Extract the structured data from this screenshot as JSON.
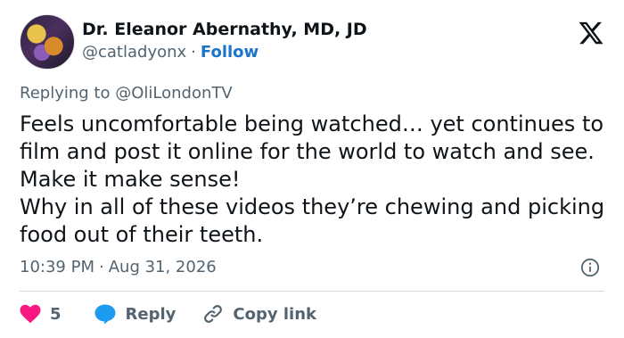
{
  "author": {
    "display_name": "Dr. Eleanor Abernathy, MD, JD",
    "handle": "@catladyonx",
    "separator": "·",
    "follow_label": "Follow"
  },
  "reply_context": {
    "prefix": "Replying to",
    "mention": "@OliLondonTV"
  },
  "tweet": {
    "lines": [
      "Feels uncomfortable being watched… yet continues to film and post it online for the world to watch and see. Make it make sense!",
      "Why in all of these videos they’re chewing and picking food out of their teeth."
    ],
    "time": "10:39 PM",
    "separator": "·",
    "date": "Aug 31, 2026"
  },
  "actions": {
    "like_count": "5",
    "reply_label": "Reply",
    "copy_label": "Copy link"
  },
  "colors": {
    "text": "#0f1419",
    "muted": "#536471",
    "follow": "#1d74c9",
    "like": "#f91880",
    "reply_bubble": "#1d9bf0",
    "divider": "#cfd9de"
  },
  "icons": [
    "x-logo-icon",
    "info-icon",
    "heart-icon",
    "reply-bubble-icon",
    "link-icon"
  ]
}
